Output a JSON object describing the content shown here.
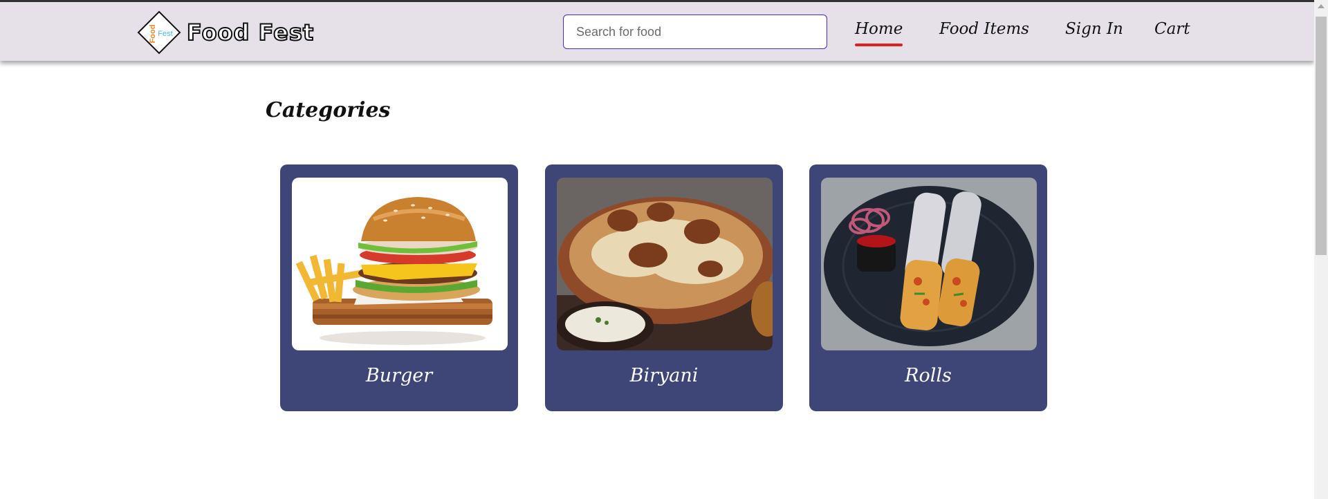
{
  "brand": {
    "name": "Food Fest",
    "logo_word_top": "Food",
    "logo_word_bottom": "Fest"
  },
  "search": {
    "placeholder": "Search for food",
    "value": ""
  },
  "nav": {
    "items": [
      {
        "label": "Home",
        "active": true
      },
      {
        "label": "Food Items",
        "active": false
      },
      {
        "label": "Sign In",
        "active": false
      },
      {
        "label": "Cart",
        "active": false
      }
    ]
  },
  "main": {
    "title": "Categories",
    "categories": [
      {
        "label": "Burger",
        "image": "burger-image"
      },
      {
        "label": "Biryani",
        "image": "biryani-image"
      },
      {
        "label": "Rolls",
        "image": "rolls-image"
      }
    ]
  },
  "colors": {
    "navbar_bg": "#e6e1e9",
    "card_bg": "#3e4577",
    "active_underline": "#e02020",
    "search_border": "#4c28c8"
  }
}
